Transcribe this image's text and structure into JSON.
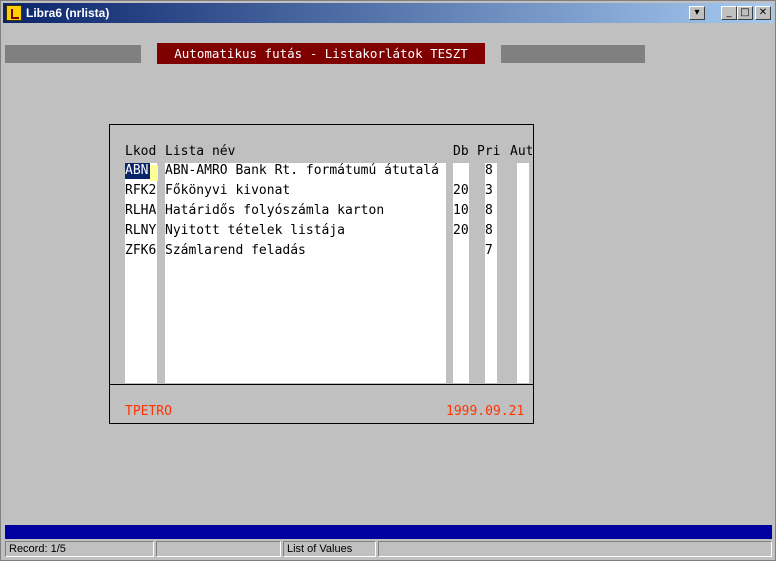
{
  "window": {
    "title": "Libra6 (nrlista)"
  },
  "form": {
    "title": "Automatikus futás - Listakorlátok TESZT"
  },
  "lov": {
    "headers": {
      "lkod": "Lkod",
      "lista_nev": "Lista név",
      "db": "Db",
      "pri": "Pri",
      "aut": "Aut"
    },
    "rows": [
      {
        "lkod": "ABN",
        "lista_nev": "ABN-AMRO Bank Rt. formátumú átutalá",
        "db": "",
        "pri": "8"
      },
      {
        "lkod": "RFK2",
        "lista_nev": "Főkönyvi kivonat",
        "db": "20",
        "pri": "3"
      },
      {
        "lkod": "RLHA",
        "lista_nev": "Határidős folyószámla karton",
        "db": "10",
        "pri": "8"
      },
      {
        "lkod": "RLNY",
        "lista_nev": "Nyitott tételek listája",
        "db": "20",
        "pri": "8"
      },
      {
        "lkod": "ZFK6",
        "lista_nev": "Számlarend feladás",
        "db": "",
        "pri": "7"
      }
    ],
    "footer": {
      "user": "TPETRO",
      "date": "1999.09.21"
    }
  },
  "statusbar": {
    "record": "Record: 1/5",
    "mode": "List of Values"
  },
  "colors": {
    "title_bg": "#800000",
    "footer_text": "#ff3300",
    "selection": "#0a246a"
  }
}
